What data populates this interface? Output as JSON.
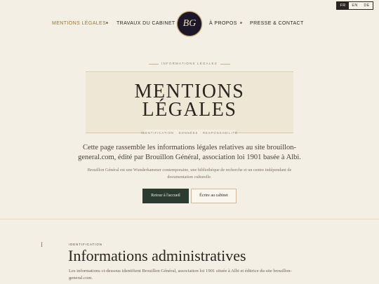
{
  "languages": {
    "items": [
      "FR",
      "EN",
      "DE"
    ],
    "active": "FR"
  },
  "nav": {
    "mentions": "MENTIONS LÉGALES",
    "travaux": "TRAVAUX DU CABINET",
    "apropos": "À PROPOS",
    "presse": "PRESSE & CONTACT",
    "logo_text": "BG"
  },
  "hero": {
    "kicker": "INFORMATIONS LÉGALES",
    "title_line1": "MENTIONS",
    "title_line2": "LÉGALES",
    "subtitle": "IDENTIFICATION · DONNÉES · RESPONSABILITÉ",
    "lead": "Cette page rassemble les informations légales relatives au site brouillon-general.com, édité par Brouillon Général, association loi 1901 basée à Albi.",
    "small": "Brouillon Général est une Wunderkammer contemporaine, une bibliothèque de recherche et un centre indépendant de documentation culturelle.",
    "btn_home": "Retour à l'accueil",
    "btn_write": "Écrire au cabinet"
  },
  "section": {
    "number": "I",
    "kicker": "IDENTIFICATION",
    "title": "Informations administratives",
    "text": "Les informations ci-dessous identifient Brouillon Général, association loi 1901 située à Albi et éditrice du site brouillon-general.com."
  },
  "colors": {
    "background": "#f4efe5",
    "accent_gold": "#9a7535",
    "primary_button": "#2c3b30",
    "logo_bg": "#1d1528"
  }
}
